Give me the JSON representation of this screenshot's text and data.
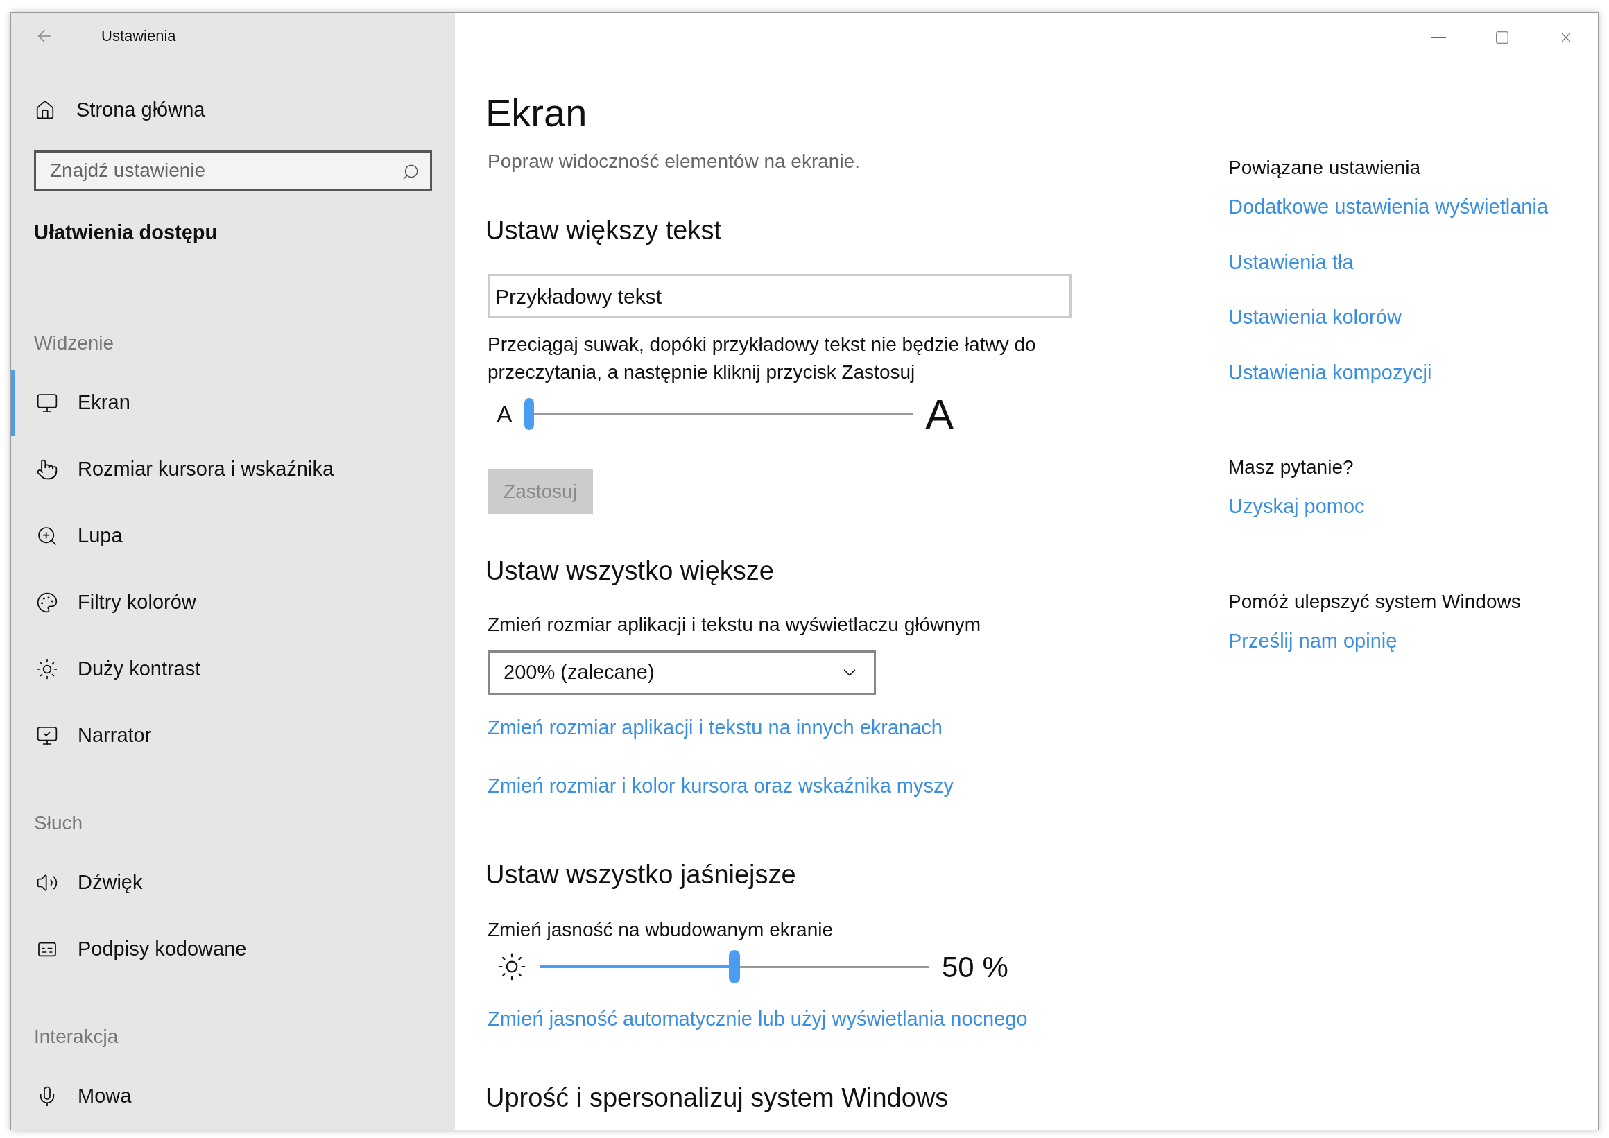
{
  "window": {
    "title": "Ustawienia"
  },
  "sidebar": {
    "home": {
      "label": "Strona główna"
    },
    "search": {
      "placeholder": "Znajdź ustawienie"
    },
    "category": "Ułatwienia dostępu",
    "groups": [
      {
        "heading": "Widzenie",
        "items": [
          {
            "label": "Ekran",
            "selected": true
          },
          {
            "label": "Rozmiar kursora i wskaźnika",
            "selected": false
          },
          {
            "label": "Lupa",
            "selected": false
          },
          {
            "label": "Filtry kolorów",
            "selected": false
          },
          {
            "label": "Duży kontrast",
            "selected": false
          },
          {
            "label": "Narrator",
            "selected": false
          }
        ]
      },
      {
        "heading": "Słuch",
        "items": [
          {
            "label": "Dźwięk",
            "selected": false
          },
          {
            "label": "Podpisy kodowane",
            "selected": false
          }
        ]
      },
      {
        "heading": "Interakcja",
        "items": [
          {
            "label": "Mowa",
            "selected": false
          }
        ]
      }
    ]
  },
  "main": {
    "title": "Ekran",
    "subtitle": "Popraw widoczność elementów na ekranie.",
    "text_size": {
      "heading": "Ustaw większy tekst",
      "sample": "Przykładowy tekst",
      "instructions": "Przeciągaj suwak, dopóki przykładowy tekst nie będzie łatwy do przeczytania, a następnie kliknij przycisk Zastosuj",
      "small_label": "A",
      "large_label": "A",
      "level": 0,
      "apply": {
        "label": "Zastosuj",
        "disabled": true
      }
    },
    "scale": {
      "heading": "Ustaw wszystko większe",
      "label": "Zmień rozmiar aplikacji i tekstu na wyświetlaczu głównym",
      "value": "200% (zalecane)",
      "links": [
        "Zmień rozmiar aplikacji i tekstu na innych ekranach",
        "Zmień rozmiar i kolor kursora oraz wskaźnika myszy"
      ]
    },
    "brightness": {
      "heading": "Ustaw wszystko jaśniejsze",
      "label": "Zmień jasność na wbudowanym ekranie",
      "level": 0.5,
      "reading": "50 %",
      "link": "Zmień jasność automatycznie lub użyj wyświetlania nocnego"
    },
    "next_heading": "Uprość i spersonalizuj system Windows"
  },
  "related": [
    {
      "heading": "Powiązane ustawienia",
      "links": [
        "Dodatkowe ustawienia wyświetlania",
        "Ustawienia tła",
        "Ustawienia kolorów",
        "Ustawienia kompozycji"
      ]
    },
    {
      "heading": "Masz pytanie?",
      "links": [
        "Uzyskaj pomoc"
      ]
    },
    {
      "heading": "Pomóż ulepszyć system Windows",
      "links": [
        "Prześlij nam opinię"
      ]
    }
  ]
}
